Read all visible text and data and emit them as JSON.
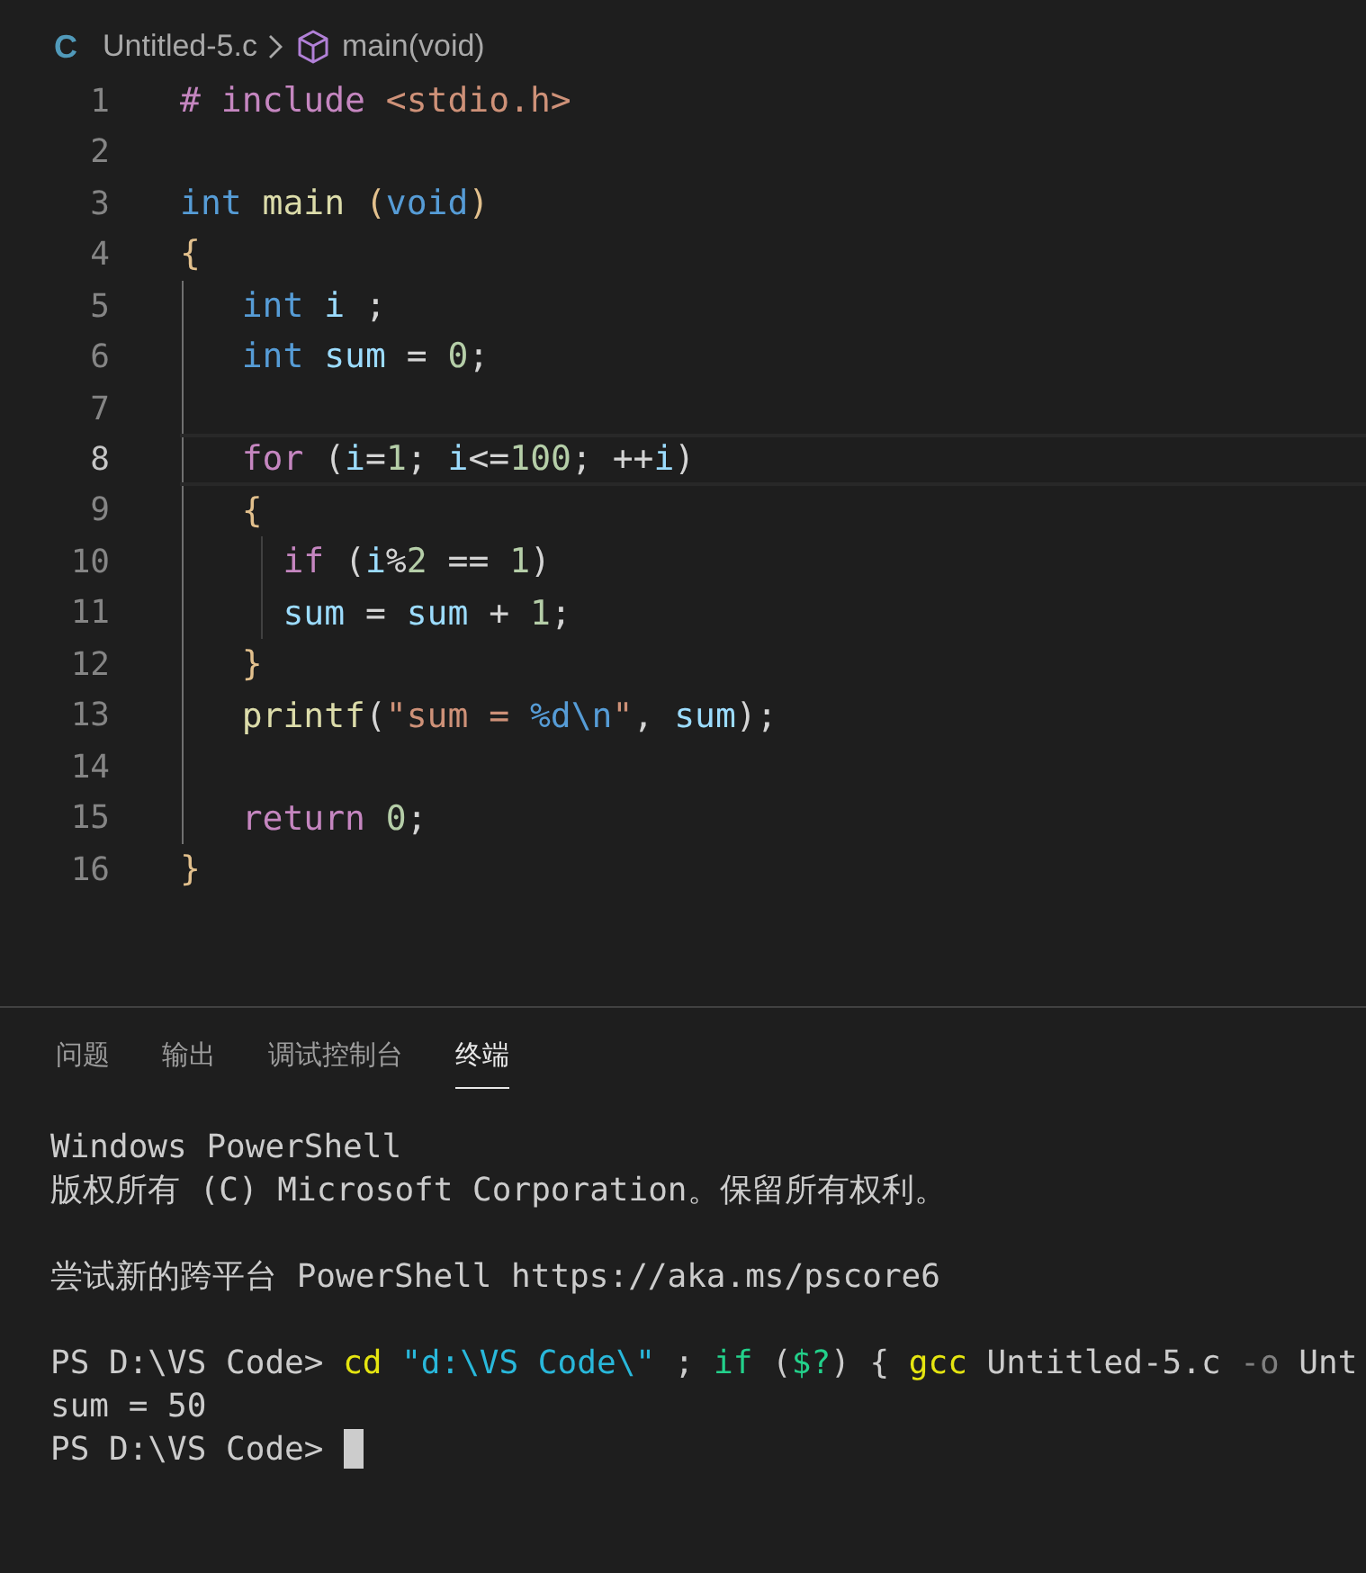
{
  "breadcrumb": {
    "file_icon": "C",
    "file": "Untitled-5.c",
    "symbol": "main(void)"
  },
  "editor": {
    "lines": [
      {
        "number": "1",
        "current": false,
        "tokens": [
          {
            "kind": "preproc",
            "text": "# include "
          },
          {
            "kind": "string",
            "text": "<stdio.h>"
          }
        ]
      },
      {
        "number": "2",
        "current": false
      },
      {
        "number": "3",
        "current": false,
        "tokens": [
          {
            "kind": "type",
            "text": "int "
          },
          {
            "kind": "function",
            "text": "main "
          },
          {
            "kind": "bracket",
            "text": "("
          },
          {
            "kind": "type",
            "text": "void"
          },
          {
            "kind": "bracket",
            "text": ")"
          }
        ]
      },
      {
        "number": "4",
        "current": false,
        "tokens": [
          {
            "kind": "bracket",
            "text": "{"
          }
        ]
      },
      {
        "number": "5",
        "current": false,
        "tokens": [
          {
            "kind": "type",
            "text": "   int "
          },
          {
            "kind": "variable",
            "text": "i"
          },
          {
            "kind": "plain",
            "text": " ;"
          }
        ]
      },
      {
        "number": "6",
        "current": false,
        "tokens": [
          {
            "kind": "type",
            "text": "   int "
          },
          {
            "kind": "variable",
            "text": "sum"
          },
          {
            "kind": "plain",
            "text": " = "
          },
          {
            "kind": "number",
            "text": "0"
          },
          {
            "kind": "plain",
            "text": ";"
          }
        ]
      },
      {
        "number": "7",
        "current": false
      },
      {
        "number": "8",
        "current": true,
        "tokens": [
          {
            "kind": "control",
            "text": "   for"
          },
          {
            "kind": "plain",
            "text": " ("
          },
          {
            "kind": "variable",
            "text": "i"
          },
          {
            "kind": "plain",
            "text": "="
          },
          {
            "kind": "number",
            "text": "1"
          },
          {
            "kind": "plain",
            "text": "; "
          },
          {
            "kind": "variable",
            "text": "i"
          },
          {
            "kind": "plain",
            "text": "<="
          },
          {
            "kind": "number",
            "text": "100"
          },
          {
            "kind": "plain",
            "text": "; ++"
          },
          {
            "kind": "variable",
            "text": "i"
          },
          {
            "kind": "plain",
            "text": ")"
          }
        ]
      },
      {
        "number": "9",
        "current": false,
        "tokens": [
          {
            "kind": "bracket",
            "text": "   {"
          }
        ]
      },
      {
        "number": "10",
        "current": false,
        "tokens": [
          {
            "kind": "control",
            "text": "     if"
          },
          {
            "kind": "plain",
            "text": " ("
          },
          {
            "kind": "variable",
            "text": "i"
          },
          {
            "kind": "plain",
            "text": "%"
          },
          {
            "kind": "number",
            "text": "2"
          },
          {
            "kind": "plain",
            "text": " == "
          },
          {
            "kind": "number",
            "text": "1"
          },
          {
            "kind": "plain",
            "text": ")"
          }
        ]
      },
      {
        "number": "11",
        "current": false,
        "tokens": [
          {
            "kind": "variable",
            "text": "     sum"
          },
          {
            "kind": "plain",
            "text": " = "
          },
          {
            "kind": "variable",
            "text": "sum"
          },
          {
            "kind": "plain",
            "text": " + "
          },
          {
            "kind": "number",
            "text": "1"
          },
          {
            "kind": "plain",
            "text": ";"
          }
        ]
      },
      {
        "number": "12",
        "current": false,
        "tokens": [
          {
            "kind": "bracket",
            "text": "   }"
          }
        ]
      },
      {
        "number": "13",
        "current": false,
        "tokens": [
          {
            "kind": "function",
            "text": "   printf"
          },
          {
            "kind": "plain",
            "text": "("
          },
          {
            "kind": "string",
            "text": "\"sum = "
          },
          {
            "kind": "escape",
            "text": "%d\\n"
          },
          {
            "kind": "string",
            "text": "\""
          },
          {
            "kind": "plain",
            "text": ", "
          },
          {
            "kind": "variable",
            "text": "sum"
          },
          {
            "kind": "plain",
            "text": ");"
          }
        ]
      },
      {
        "number": "14",
        "current": false
      },
      {
        "number": "15",
        "current": false,
        "tokens": [
          {
            "kind": "control",
            "text": "   return "
          },
          {
            "kind": "number",
            "text": "0"
          },
          {
            "kind": "plain",
            "text": ";"
          }
        ]
      },
      {
        "number": "16",
        "current": false,
        "tokens": [
          {
            "kind": "bracket",
            "text": "}"
          }
        ]
      }
    ]
  },
  "panel": {
    "tabs": [
      {
        "label": "问题",
        "selected": false
      },
      {
        "label": "输出",
        "selected": false
      },
      {
        "label": "调试控制台",
        "selected": false
      },
      {
        "label": "终端",
        "selected": true
      }
    ],
    "terminal_blocks": [
      [
        {
          "tokens": [
            {
              "kind": "plain",
              "text": "Windows PowerShell"
            }
          ]
        },
        {
          "tokens": [
            {
              "kind": "plain",
              "text": "版权所有 (C) Microsoft Corporation。保留所有权利。"
            }
          ]
        }
      ],
      [
        {
          "tokens": [
            {
              "kind": "plain",
              "text": "尝试新的跨平台 PowerShell https://aka.ms/pscore6"
            }
          ]
        }
      ],
      [
        {
          "tokens": [
            {
              "kind": "plain",
              "text": "PS D:\\VS Code> "
            },
            {
              "kind": "command",
              "text": "cd "
            },
            {
              "kind": "quoted",
              "text": "\"d:\\VS Code\\\""
            },
            {
              "kind": "plain",
              "text": " ; "
            },
            {
              "kind": "keyword",
              "text": "if"
            },
            {
              "kind": "plain",
              "text": " ("
            },
            {
              "kind": "keyword",
              "text": "$?"
            },
            {
              "kind": "plain",
              "text": ") { "
            },
            {
              "kind": "command",
              "text": "gcc"
            },
            {
              "kind": "plain",
              "text": " Untitled-5.c "
            },
            {
              "kind": "flag",
              "text": "-o"
            },
            {
              "kind": "plain",
              "text": " Unt"
            }
          ]
        },
        {
          "tokens": [
            {
              "kind": "plain",
              "text": "sum = 50"
            }
          ]
        },
        {
          "tokens": [
            {
              "kind": "plain",
              "text": "PS D:\\VS Code> "
            }
          ],
          "cursor": true
        }
      ]
    ]
  }
}
